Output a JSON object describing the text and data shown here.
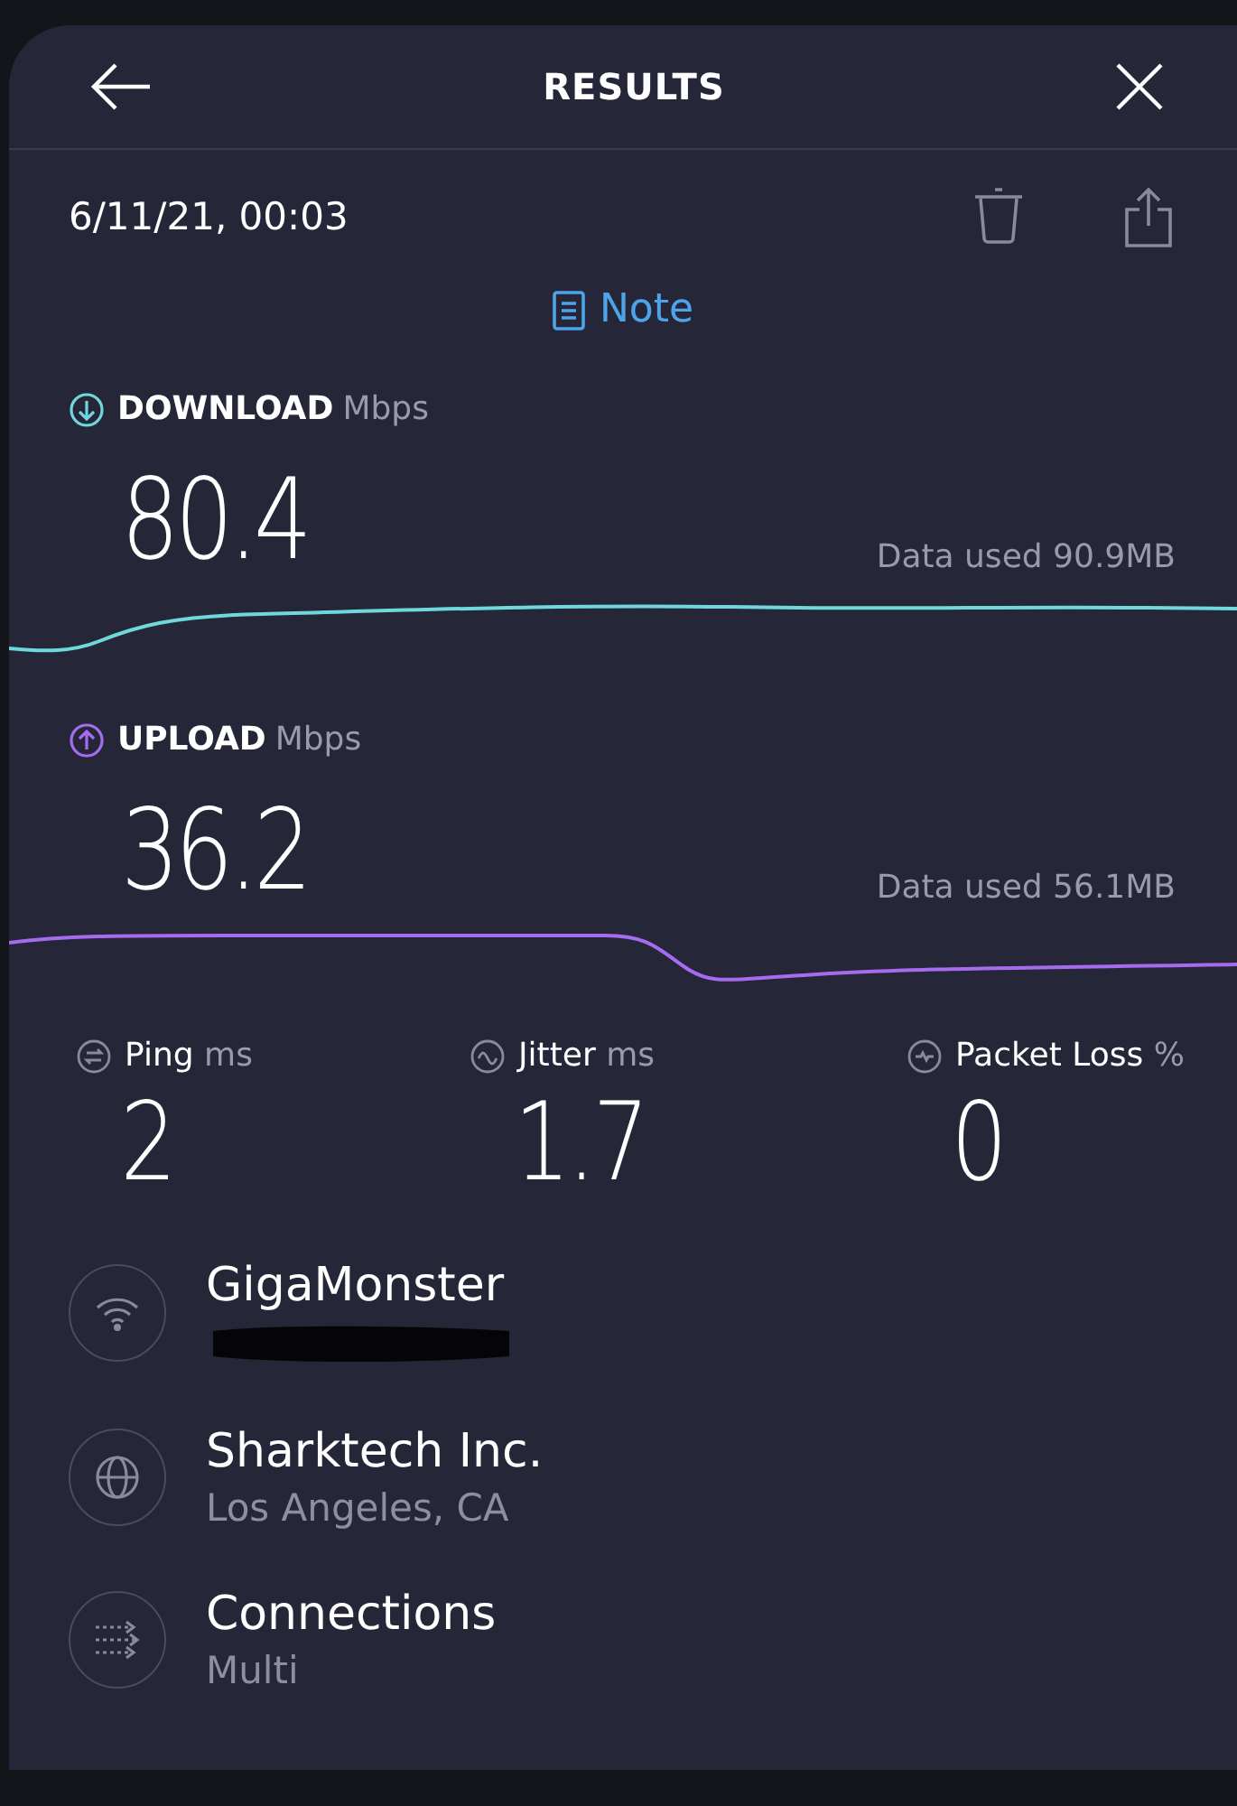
{
  "header": {
    "title": "RESULTS"
  },
  "date": "6/11/21, 00:03",
  "note": {
    "label": "Note"
  },
  "speeds": [
    {
      "kind": "download",
      "label": "DOWNLOAD",
      "unit": "Mbps",
      "value": "80.4",
      "data_used": "Data used 90.9MB",
      "color": "#6fd8dc"
    },
    {
      "kind": "upload",
      "label": "UPLOAD",
      "unit": "Mbps",
      "value": "36.2",
      "data_used": "Data used 56.1MB",
      "color": "#a66cf0"
    }
  ],
  "stats": [
    {
      "kind": "ping",
      "label": "Ping",
      "unit": "ms",
      "value": "2"
    },
    {
      "kind": "jitter",
      "label": "Jitter",
      "unit": "ms",
      "value": "1.7"
    },
    {
      "kind": "loss",
      "label": "Packet Loss",
      "unit": "%",
      "value": "0"
    }
  ],
  "details": [
    {
      "kind": "wifi",
      "title": "GigaMonster",
      "redacted": true
    },
    {
      "kind": "globe",
      "title": "Sharktech Inc.",
      "subtitle": "Los Angeles, CA"
    },
    {
      "kind": "connections",
      "title": "Connections",
      "subtitle": "Multi"
    }
  ]
}
